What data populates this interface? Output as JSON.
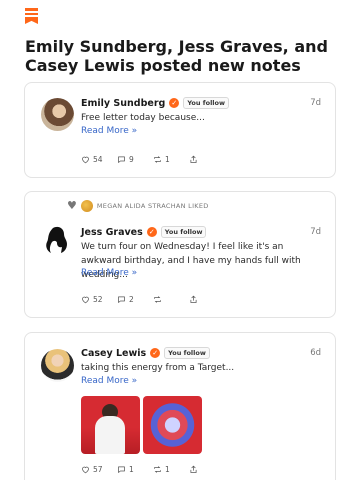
{
  "headline": "Emily Sundberg, Jess Graves, and Casey Lewis posted new notes",
  "colors": {
    "accent": "#ff6719",
    "link": "#3867c8"
  },
  "icons": {
    "logo": "substack-logo",
    "like": "heart-icon",
    "comment": "comment-icon",
    "restack": "restack-icon",
    "share": "share-icon",
    "verified": "verified-check-icon"
  },
  "notes": [
    {
      "author": "Emily Sundberg",
      "follow_label": "You follow",
      "time": "7d",
      "text": "Free letter today because...",
      "read_more": "Read More »",
      "likes": "54",
      "comments": "9",
      "restacks": "1"
    },
    {
      "liked_by": "MEGAN ALIDA STRACHAN LIKED",
      "author": "Jess Graves",
      "follow_label": "You follow",
      "time": "7d",
      "text": "We turn four on Wednesday! I feel like it's an awkward birthday, and I have my hands full with wedding...",
      "read_more": "Read More »",
      "likes": "52",
      "comments": "2",
      "restacks": ""
    },
    {
      "author": "Casey Lewis",
      "follow_label": "You follow",
      "time": "6d",
      "text": "taking this energy from a Target...",
      "read_more": "Read More »",
      "likes": "57",
      "comments": "1",
      "restacks": "1"
    }
  ]
}
